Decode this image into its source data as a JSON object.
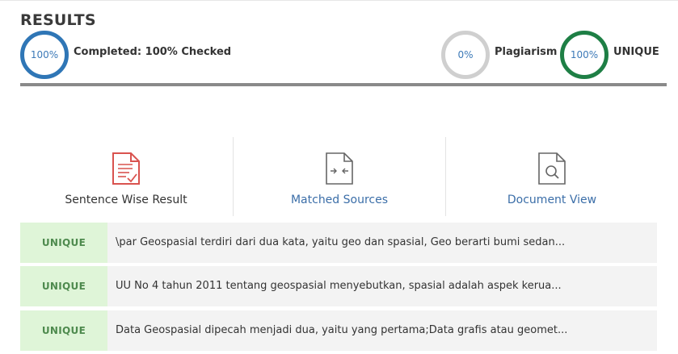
{
  "header": {
    "title": "RESULTS"
  },
  "summary": {
    "completed_value": "100%",
    "completed_label": "Completed: 100% Checked",
    "plagiarism_value": "0%",
    "plagiarism_label": "Plagiarism",
    "unique_value": "100%",
    "unique_label": "UNIQUE",
    "colors": {
      "completed": "#2f76b6",
      "plagiarism": "#cfcfcf",
      "unique": "#1e7f45"
    }
  },
  "tabs": [
    {
      "label": "Sentence Wise Result",
      "icon": "document-check-icon"
    },
    {
      "label": "Matched Sources",
      "icon": "document-compare-icon"
    },
    {
      "label": "Document View",
      "icon": "document-search-icon"
    }
  ],
  "rows": [
    {
      "status": "UNIQUE",
      "text": "\\par Geospasial terdiri dari dua kata, yaitu geo dan spasial, Geo berarti bumi sedan..."
    },
    {
      "status": "UNIQUE",
      "text": "UU No 4 tahun 2011 tentang geospasial menyebutkan, spasial adalah aspek kerua..."
    },
    {
      "status": "UNIQUE",
      "text": "Data Geospasial dipecah menjadi dua, yaitu yang pertama;Data grafis atau geomet..."
    }
  ]
}
